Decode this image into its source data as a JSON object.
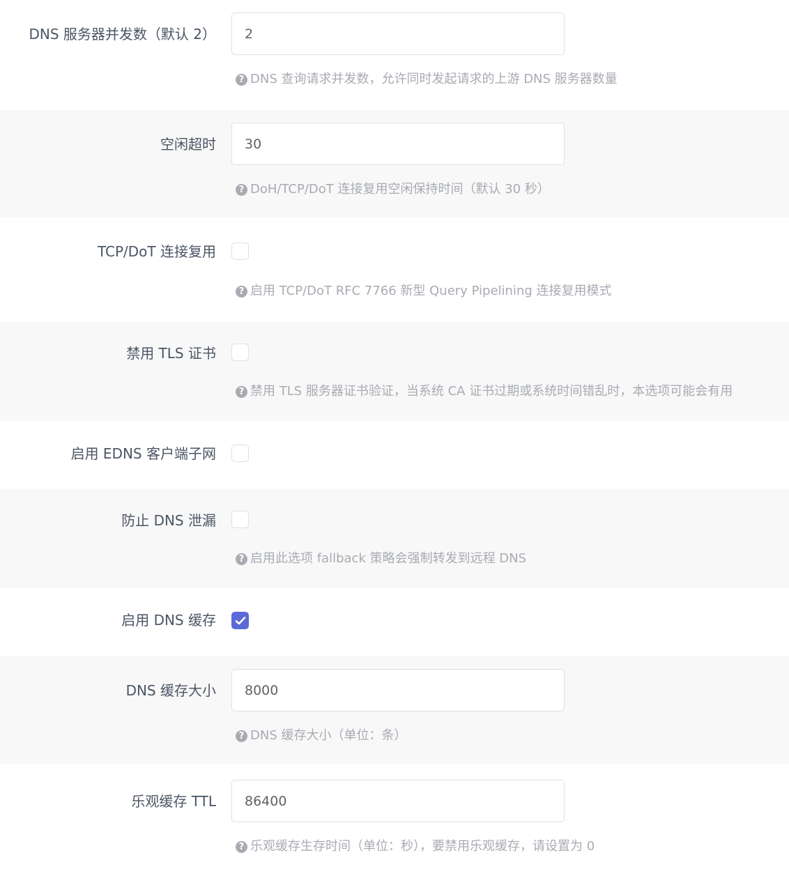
{
  "help_glyph": "?",
  "fields": {
    "concurrency": {
      "label": "DNS 服务器并发数（默认 2）",
      "value": "2",
      "help": "DNS 查询请求并发数，允许同时发起请求的上游 DNS 服务器数量"
    },
    "idle_timeout": {
      "label": "空闲超时",
      "value": "30",
      "help": "DoH/TCP/DoT 连接复用空闲保持时间（默认 30 秒）"
    },
    "pipelining": {
      "label": "TCP/DoT 连接复用",
      "checked": false,
      "help": "启用 TCP/DoT RFC 7766 新型 Query Pipelining 连接复用模式"
    },
    "disable_tls": {
      "label": "禁用 TLS 证书",
      "checked": false,
      "help": "禁用 TLS 服务器证书验证，当系统 CA 证书过期或系统时间错乱时，本选项可能会有用"
    },
    "edns_subnet": {
      "label": "启用 EDNS 客户端子网",
      "checked": false
    },
    "dns_leak": {
      "label": "防止 DNS 泄漏",
      "checked": false,
      "help": "启用此选项 fallback 策略会强制转发到远程 DNS"
    },
    "dns_cache": {
      "label": "启用 DNS 缓存",
      "checked": true
    },
    "cache_size": {
      "label": "DNS 缓存大小",
      "value": "8000",
      "help": "DNS 缓存大小（单位：条）"
    },
    "optimistic_ttl": {
      "label": "乐观缓存 TTL",
      "value": "86400",
      "help": "乐观缓存生存时间（单位：秒），要禁用乐观缓存，请设置为 0"
    }
  }
}
